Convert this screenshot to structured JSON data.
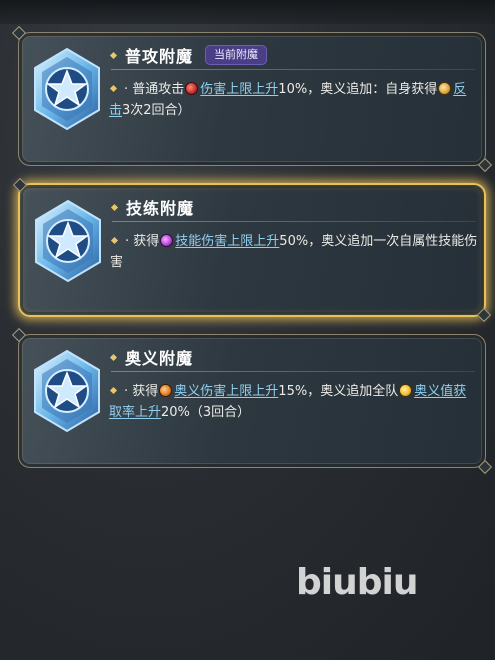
{
  "cards": [
    {
      "title": "普攻附魔",
      "badge": "当前附魔",
      "selected": false,
      "desc": {
        "pre": "普通攻击",
        "link1": "伤害上限上升",
        "mid": "10%，奥义追加：自身获得",
        "link2": "反击",
        "post": "3次2回合）"
      }
    },
    {
      "title": "技练附魔",
      "selected": true,
      "desc": {
        "pre": "获得",
        "link1": "技能伤害上限上升",
        "post": "50%，奥义追加一次自属性技能伤害"
      }
    },
    {
      "title": "奥义附魔",
      "selected": false,
      "desc": {
        "pre": "获得",
        "link1": "奥义伤害上限上升",
        "mid": "15%，奥义追加全队",
        "link2": "奥义值获取率上升",
        "post": "20%（3回合）"
      }
    }
  ],
  "watermark": "biubiu",
  "colors": {
    "link": "#8fd0f0",
    "selected_glow": "#e8c15a",
    "badge_bg": "#4a3e88",
    "bullet": "#e9c766"
  },
  "icons": [
    "star-crystal-icon",
    "damage-cap-icon",
    "counter-icon",
    "skill-damage-icon",
    "ultimate-damage-icon",
    "ultimate-gain-icon"
  ]
}
